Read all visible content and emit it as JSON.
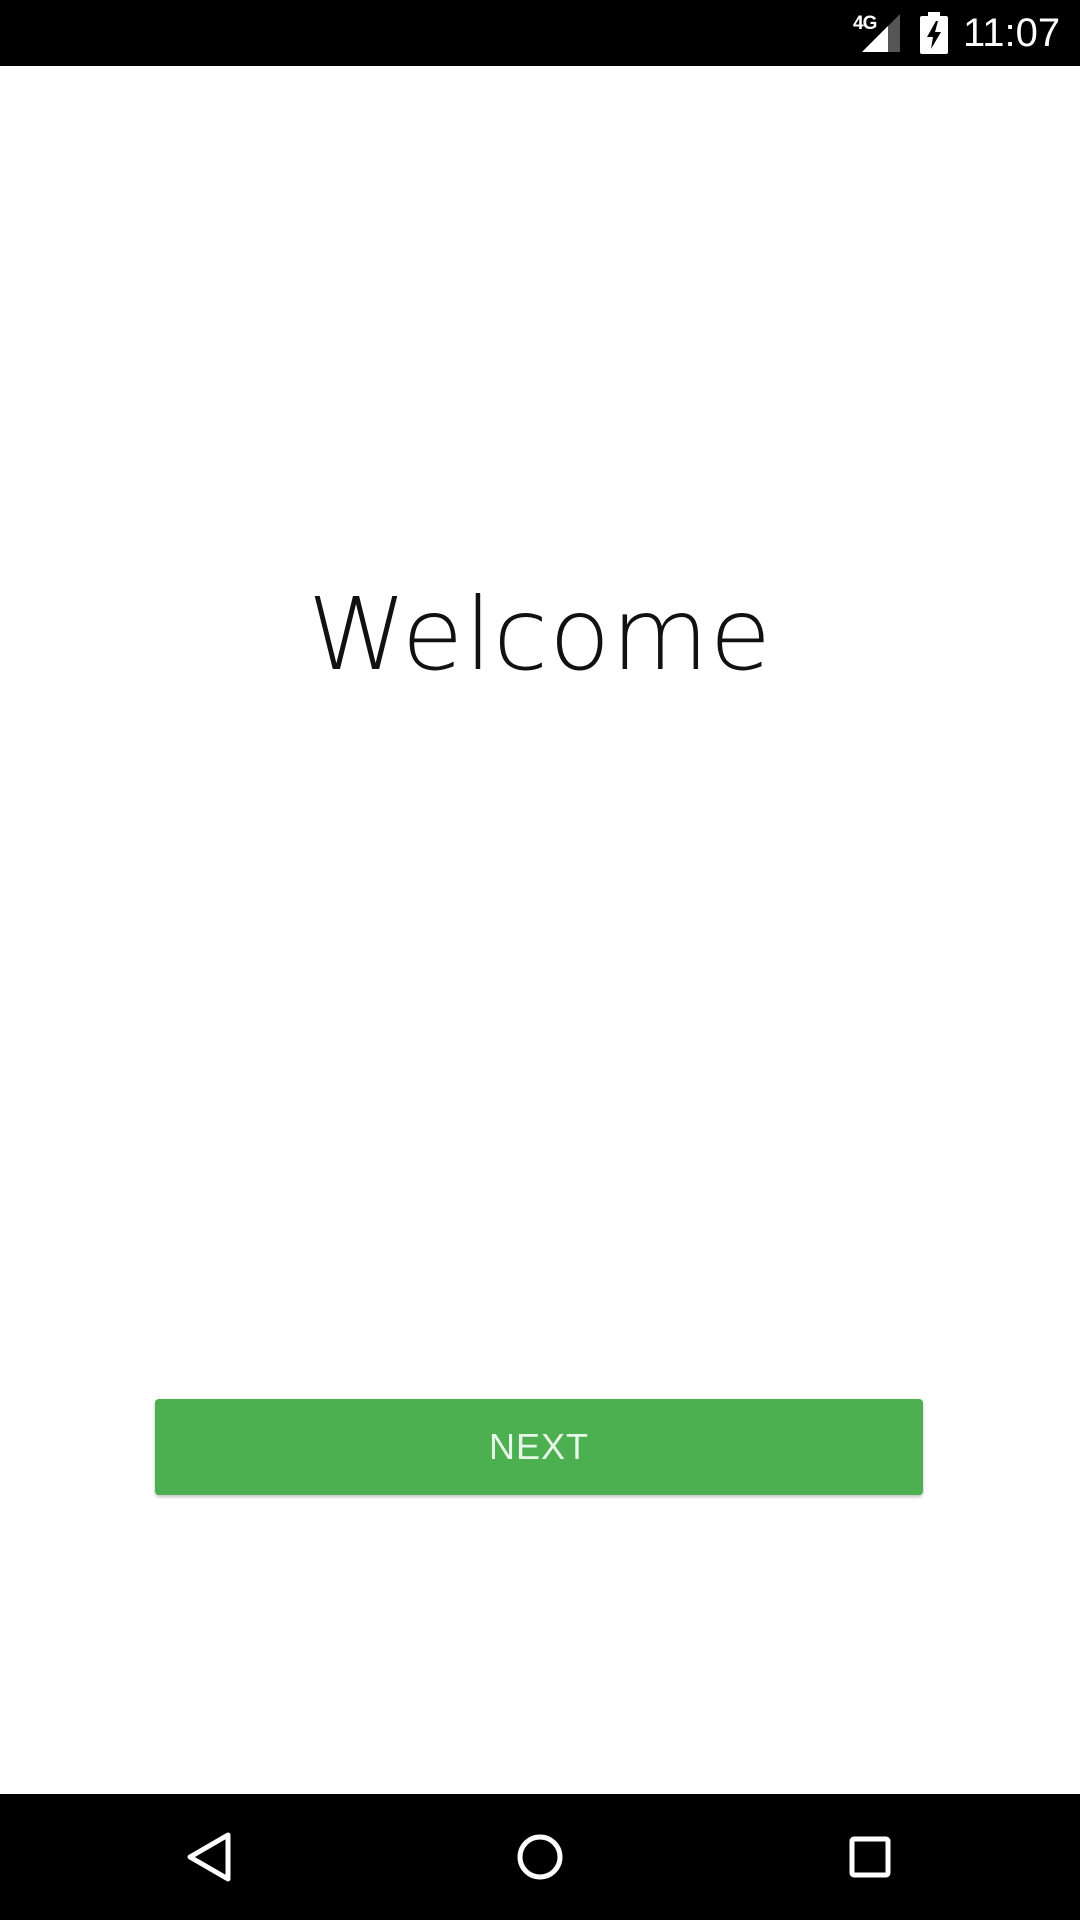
{
  "status_bar": {
    "network": "4G",
    "time": "11:07",
    "icons": [
      "signal-icon",
      "battery-charging-icon"
    ]
  },
  "main": {
    "title": "Welcome",
    "next_label": "NEXT"
  },
  "nav_bar": {
    "icons": [
      "back-icon",
      "home-icon",
      "recents-icon"
    ]
  },
  "colors": {
    "status_bar_bg": "#000000",
    "nav_bar_bg": "#000000",
    "button_bg": "#4caf50",
    "button_text": "#e8f5e9",
    "title_text": "#111111",
    "background": "#ffffff"
  }
}
